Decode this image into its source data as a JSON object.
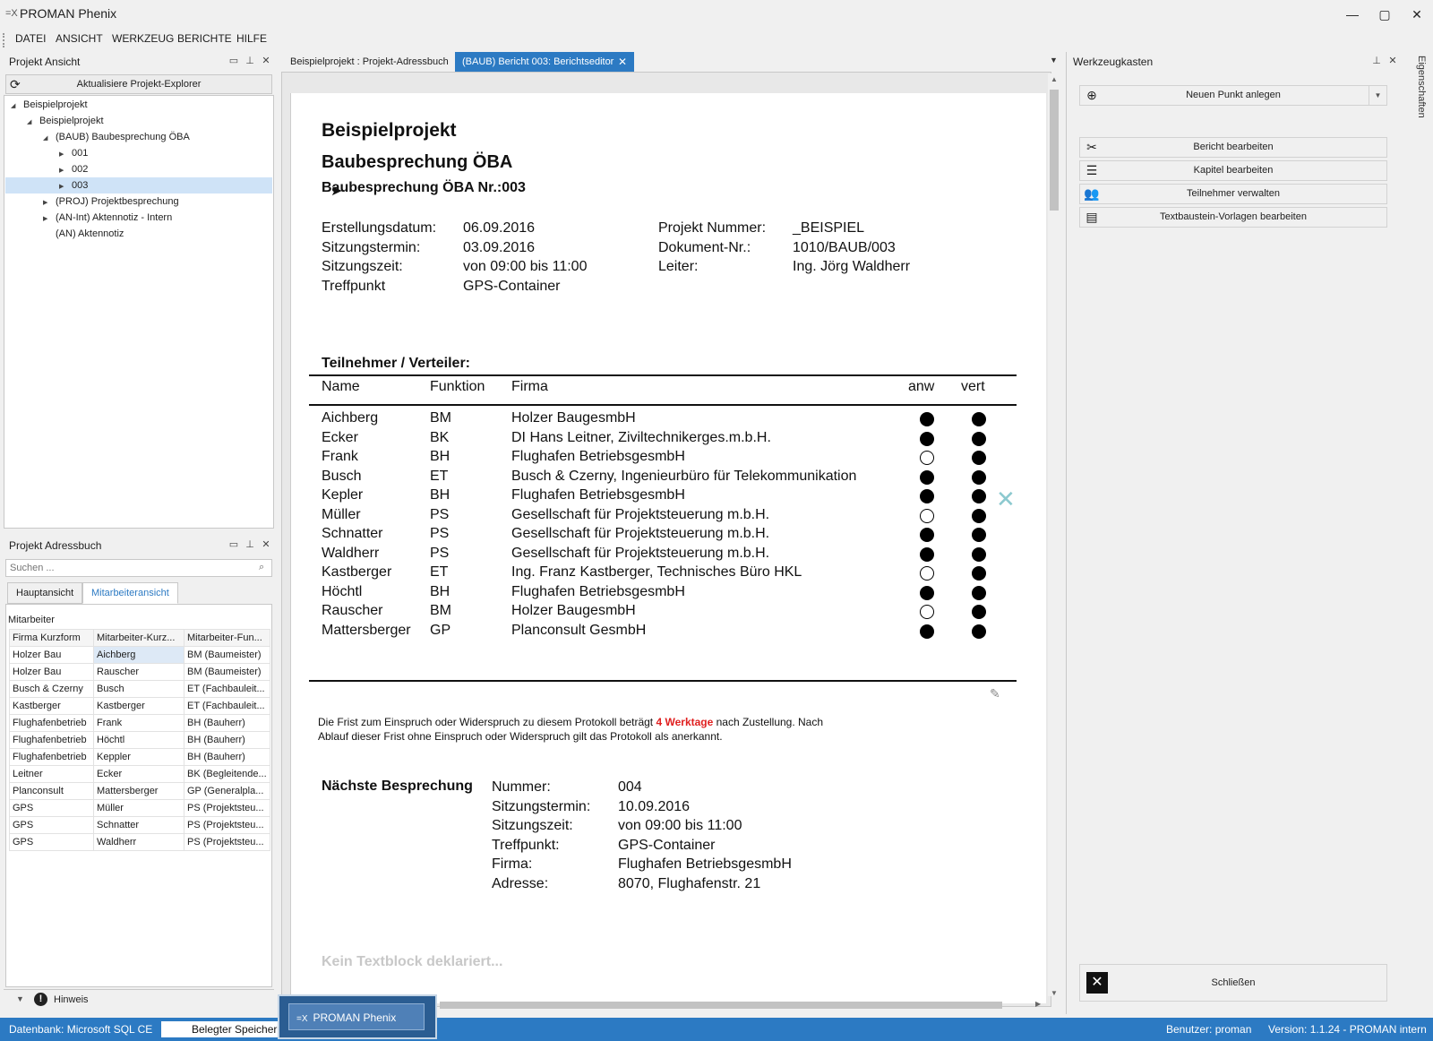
{
  "window": {
    "logo": "=X",
    "title": "PROMAN Phenix",
    "min": "—",
    "max": "▢",
    "close": "✕"
  },
  "menu": [
    "DATEI",
    "ANSICHT",
    "WERKZEUG",
    "BERICHTE",
    "HILFE"
  ],
  "project_view": {
    "title": "Projekt Ansicht",
    "refresh_label": "Aktualisiere Projekt-Explorer",
    "tree": [
      {
        "label": "Beispielprojekt",
        "indent": 0,
        "arrow": "◢"
      },
      {
        "label": "Beispielprojekt",
        "indent": 1,
        "arrow": "◢"
      },
      {
        "label": "(BAUB) Baubesprechung ÖBA",
        "indent": 2,
        "arrow": "◢"
      },
      {
        "label": "001",
        "indent": 3,
        "arrow": "▶"
      },
      {
        "label": "002",
        "indent": 3,
        "arrow": "▶"
      },
      {
        "label": "003",
        "indent": 3,
        "arrow": "▶"
      },
      {
        "label": "(PROJ) Projektbesprechung",
        "indent": 2,
        "arrow": "▶"
      },
      {
        "label": "(AN-Int) Aktennotiz - Intern",
        "indent": 2,
        "arrow": "▶"
      },
      {
        "label": "(AN) Aktennotiz",
        "indent": 2,
        "arrow": ""
      }
    ]
  },
  "address_book": {
    "title": "Projekt Adressbuch",
    "search_placeholder": "Suchen ...",
    "tabs": [
      "Hauptansicht",
      "Mitarbeiteransicht"
    ],
    "section": "Mitarbeiter",
    "columns": [
      "Firma Kurzform",
      "Mitarbeiter-Kurz...",
      "Mitarbeiter-Fun..."
    ],
    "rows": [
      [
        "Holzer Bau",
        "Aichberg",
        "BM (Baumeister)"
      ],
      [
        "Holzer Bau",
        "Rauscher",
        "BM (Baumeister)"
      ],
      [
        "Busch & Czerny",
        "Busch",
        "ET (Fachbauleit..."
      ],
      [
        "Kastberger",
        "Kastberger",
        "ET (Fachbauleit..."
      ],
      [
        "Flughafenbetrieb",
        "Frank",
        "BH (Bauherr)"
      ],
      [
        "Flughafenbetrieb",
        "Höchtl",
        "BH (Bauherr)"
      ],
      [
        "Flughafenbetrieb",
        "Keppler",
        "BH (Bauherr)"
      ],
      [
        "Leitner",
        "Ecker",
        "BK (Begleitende..."
      ],
      [
        "Planconsult",
        "Mattersberger",
        "GP (Generalpla..."
      ],
      [
        "GPS",
        "Müller",
        "PS (Projektsteu..."
      ],
      [
        "GPS",
        "Schnatter",
        "PS (Projektsteu..."
      ],
      [
        "GPS",
        "Waldherr",
        "PS (Projektsteu..."
      ]
    ],
    "hint": "Hinweis"
  },
  "doc_tabs": [
    "Beispielprojekt : Projekt-Adressbuch",
    "(BAUB) Bericht 003: Berichtseditor"
  ],
  "report": {
    "project": "Beispielprojekt",
    "type": "Baubesprechung ÖBA",
    "number_title": "Baubesprechung ÖBA Nr.:003",
    "info_left": [
      [
        "Erstellungsdatum:",
        "06.09.2016"
      ],
      [
        "Sitzungstermin:",
        "03.09.2016"
      ],
      [
        "Sitzungszeit:",
        "von 09:00 bis 11:00"
      ],
      [
        "Treffpunkt",
        "GPS-Container"
      ]
    ],
    "info_right": [
      [
        "Projekt Nummer:",
        "_BEISPIEL"
      ],
      [
        "Dokument-Nr.:",
        "1010/BAUB/003"
      ],
      [
        "Leiter:",
        "Ing. Jörg Waldherr"
      ]
    ],
    "participants_title": "Teilnehmer / Verteiler:",
    "participants_columns": [
      "Name",
      "Funktion",
      "Firma",
      "anw",
      "vert"
    ],
    "participants": [
      {
        "name": "Aichberg",
        "func": "BM",
        "firm": "Holzer BaugesmbH",
        "anw": true,
        "vert": true
      },
      {
        "name": "Ecker",
        "func": "BK",
        "firm": "DI Hans Leitner, Ziviltechnikerges.m.b.H.",
        "anw": true,
        "vert": true
      },
      {
        "name": "Frank",
        "func": "BH",
        "firm": "Flughafen BetriebsgesmbH",
        "anw": false,
        "vert": true
      },
      {
        "name": "Busch",
        "func": "ET",
        "firm": "Busch & Czerny, Ingenieurbüro für Telekommunikation",
        "anw": true,
        "vert": true
      },
      {
        "name": "Kepler",
        "func": "BH",
        "firm": "Flughafen BetriebsgesmbH",
        "anw": true,
        "vert": true
      },
      {
        "name": "Müller",
        "func": "PS",
        "firm": "Gesellschaft für Projektsteuerung m.b.H.",
        "anw": false,
        "vert": true
      },
      {
        "name": "Schnatter",
        "func": "PS",
        "firm": "Gesellschaft für Projektsteuerung m.b.H.",
        "anw": true,
        "vert": true
      },
      {
        "name": "Waldherr",
        "func": "PS",
        "firm": "Gesellschaft für Projektsteuerung m.b.H.",
        "anw": true,
        "vert": true
      },
      {
        "name": "Kastberger",
        "func": "ET",
        "firm": "Ing. Franz Kastberger, Technisches Büro HKL",
        "anw": false,
        "vert": true
      },
      {
        "name": "Höchtl",
        "func": "BH",
        "firm": "Flughafen BetriebsgesmbH",
        "anw": true,
        "vert": true
      },
      {
        "name": "Rauscher",
        "func": "BM",
        "firm": "Holzer BaugesmbH",
        "anw": false,
        "vert": true
      },
      {
        "name": "Mattersberger",
        "func": "GP",
        "firm": "Planconsult GesmbH",
        "anw": true,
        "vert": true
      }
    ],
    "deadline_pre": "Die Frist zum Einspruch oder Widerspruch zu diesem Protokoll beträgt ",
    "deadline_highlight": "4 Werktage",
    "deadline_post": " nach Zustellung. Nach",
    "deadline_line2": "Ablauf dieser Frist ohne Einspruch oder Widerspruch gilt das Protokoll als anerkannt.",
    "deadline_color": "#e02020",
    "next_title": "Nächste Besprechung",
    "next": [
      [
        "Nummer:",
        "004"
      ],
      [
        "Sitzungstermin:",
        "10.09.2016"
      ],
      [
        "Sitzungszeit:",
        "von 09:00 bis 11:00"
      ],
      [
        "Treffpunkt:",
        "GPS-Container"
      ],
      [
        "Firma:",
        "Flughafen BetriebsgesmbH"
      ],
      [
        "Adresse:",
        "8070, Flughafenstr. 21"
      ]
    ],
    "no_textblock": "Kein Textblock deklariert..."
  },
  "toolbox": {
    "title": "Werkzeugkasten",
    "new_point": "Neuen Punkt anlegen",
    "buttons": [
      "Bericht bearbeiten",
      "Kapitel bearbeiten",
      "Teilnehmer verwalten",
      "Textbaustein-Vorlagen bearbeiten"
    ],
    "close": "Schließen",
    "side_tab": "Eigenschaften"
  },
  "status": {
    "db": "Datenbank: Microsoft SQL CE",
    "mem": "Belegter Speicher: (",
    "user": "Benutzer: proman",
    "version": "Version: 1.1.24 - PROMAN intern"
  },
  "taskbar": {
    "label": "PROMAN Phenix"
  },
  "colors": {
    "accent": "#2c7ac3"
  }
}
